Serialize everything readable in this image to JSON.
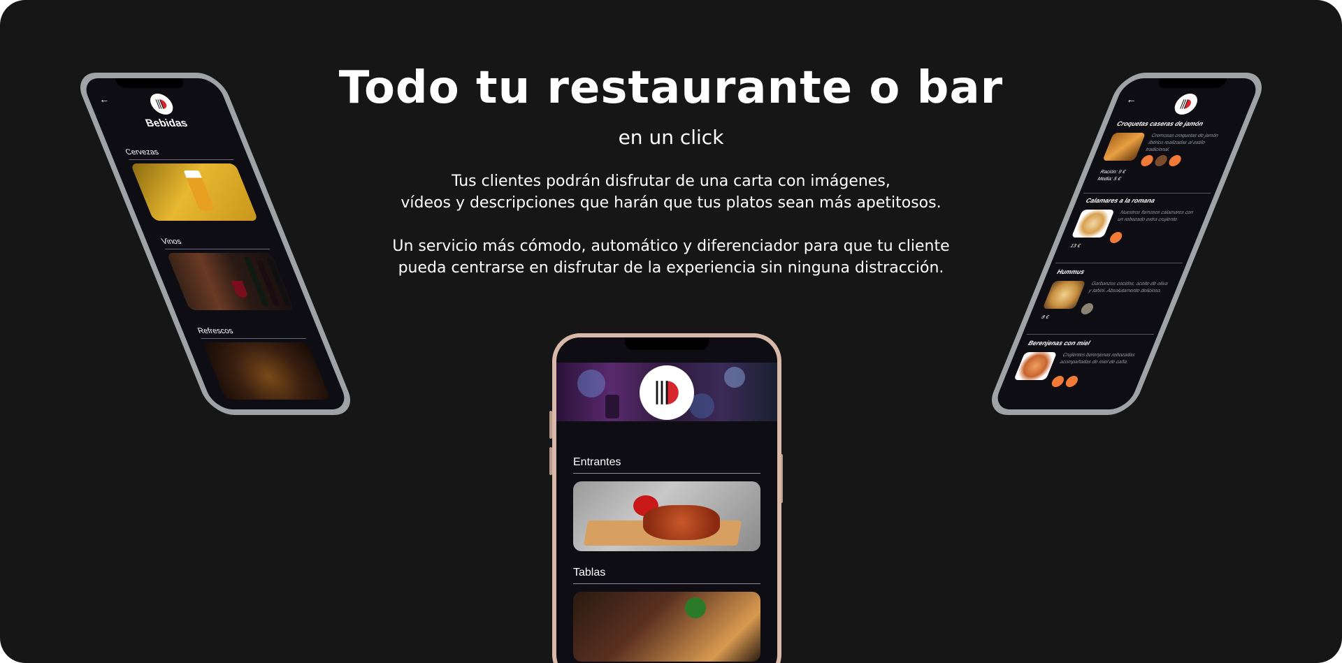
{
  "hero": {
    "title": "Todo tu restaurante o bar",
    "subtitle": "en un click",
    "para1_line1": "Tus clientes podrán disfrutar de una carta con imágenes,",
    "para1_line2": "vídeos y descripciones que harán que tus platos sean más apetitosos.",
    "para2_line1": "Un servicio más cómodo, automático y diferenciador para que tu cliente",
    "para2_line2": "pueda centrarse en disfrutar de la experiencia sin ninguna distracción."
  },
  "left_phone": {
    "back_icon": "arrow-left-icon",
    "title": "Bebidas",
    "sections": [
      {
        "label": "Cervezas"
      },
      {
        "label": "Vinos"
      },
      {
        "label": "Refrescos"
      }
    ]
  },
  "right_phone": {
    "back_icon": "arrow-left-icon",
    "items": [
      {
        "title": "Croquetas caseras de jamón",
        "description": "Cremosas croquetas de jamón ibérico realizadas al estilo tradicional.",
        "price_line1": "Ración: 9 €",
        "price_line2": "Media: 5 €"
      },
      {
        "title": "Calamares a la romana",
        "description": "Nuestros famosos calamares con un rebozado extra crujiente.",
        "price_line1": "13 €"
      },
      {
        "title": "Hummus",
        "description": "Garbanzos cocidos, aceite de oliva y tahini. Absolutamente delicioso.",
        "price_line1": "8 €"
      },
      {
        "title": "Berenjenas con miel",
        "description": "Crujientes berenjenas rebozadas acompañadas de miel de caña."
      }
    ]
  },
  "center_phone": {
    "sections": [
      {
        "label": "Entrantes"
      },
      {
        "label": "Tablas"
      }
    ]
  },
  "colors": {
    "background": "#161616",
    "screen": "#0d0d13",
    "accent_red": "#d8262e",
    "allergen_orange": "#f07a36"
  }
}
